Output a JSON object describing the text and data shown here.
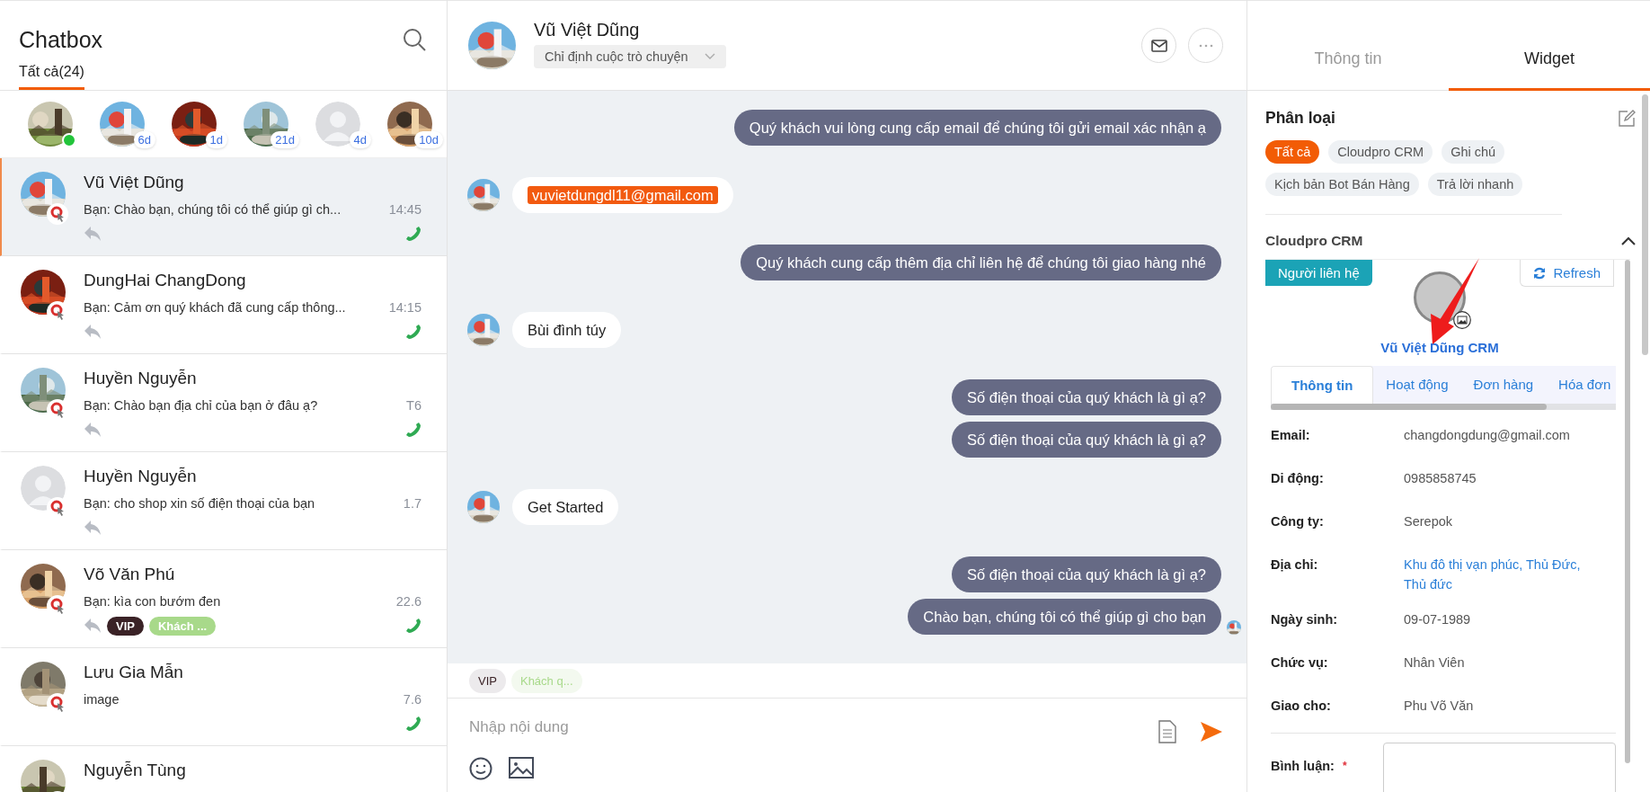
{
  "sidebar": {
    "title": "Chatbox",
    "tabs": [
      {
        "label": "Tất cả(24)",
        "selected": true
      }
    ],
    "recent": [
      {
        "kind": "picture",
        "online": true
      },
      {
        "kind": "picture",
        "online": false,
        "badge": "6d"
      },
      {
        "kind": "picture",
        "online": false,
        "badge": "1d"
      },
      {
        "kind": "picture",
        "online": false,
        "badge": "21d"
      },
      {
        "kind": "placeholder",
        "online": false,
        "badge": "4d"
      },
      {
        "kind": "picture",
        "online": false,
        "badge": "10d"
      }
    ],
    "conversations": [
      {
        "avatar": {
          "kind": "picture"
        },
        "name": "Vũ Việt Dũng",
        "preview": "Bạn: Chào bạn, chúng tôi có thể giúp gì ch...",
        "time": "14:45",
        "replied": true,
        "call": true,
        "selected": true
      },
      {
        "avatar": {
          "kind": "picture"
        },
        "name": "DungHai ChangDong",
        "preview": "Bạn: Cảm ơn quý khách đã cung cấp thông...",
        "time": "14:15",
        "replied": true,
        "call": true,
        "selected": false
      },
      {
        "avatar": {
          "kind": "picture"
        },
        "name": "Huyền Nguyễn",
        "preview": "Bạn: Chào bạn địa chỉ của bạn ở đâu ạ?",
        "time": "T6",
        "replied": true,
        "call": true,
        "selected": false
      },
      {
        "avatar": {
          "kind": "placeholder"
        },
        "name": "Huyền Nguyễn",
        "preview": "Bạn: cho shop xin số điện thoại của bạn",
        "time": "1.7",
        "replied": true,
        "call": false,
        "selected": false
      },
      {
        "avatar": {
          "kind": "picture"
        },
        "name": "Võ Văn Phú",
        "preview": "Bạn: kìa con bướm đen",
        "time": "22.6",
        "replied": true,
        "call": true,
        "selected": false,
        "tags": [
          {
            "label": "VIP",
            "color": "#3a2226"
          },
          {
            "label": "Khách ...",
            "color": "#a8d98a"
          }
        ]
      },
      {
        "avatar": {
          "kind": "picture"
        },
        "name": "Lưu Gia Mẫn",
        "preview": "image",
        "time": "7.6",
        "replied": false,
        "call": true,
        "selected": false
      },
      {
        "avatar": {
          "kind": "picture"
        },
        "name": "Nguyễn Tùng",
        "selected": false
      }
    ]
  },
  "chat": {
    "contact": "Vũ Việt Dũng",
    "assign": "Chỉ định cuộc trò chuyện",
    "messages": [
      {
        "kind": "outgoing",
        "text": "Quý khách vui lòng cung cấp email để chúng tôi gửi email xác nhận ạ"
      },
      {
        "kind": "incoming",
        "text": "vuvietdungdl11@gmail.com",
        "highlight": true
      },
      {
        "kind": "outgoing",
        "text": "Quý khách cung cấp thêm địa chỉ liên hệ để chúng tôi giao hàng nhé"
      },
      {
        "kind": "incoming",
        "text": "Bùi đình túy"
      },
      {
        "kind": "outgoing",
        "text": "Số điện thoại của quý khách là gì ạ?"
      },
      {
        "kind": "outgoing",
        "text": "Số điện thoại của quý khách là gì ạ?"
      },
      {
        "kind": "incoming",
        "text": "Get Started"
      },
      {
        "kind": "outgoing",
        "text": "Số điện thoại của quý khách là gì ạ?"
      },
      {
        "kind": "outgoing",
        "text": "Chào bạn, chúng tôi có thể giúp gì cho bạn",
        "seen": true
      }
    ],
    "tags": [
      {
        "label": "VIP",
        "color": "#3a2226"
      },
      {
        "label": "Khách q...",
        "color": "#a8d98a"
      }
    ],
    "composer": {
      "placeholder": "Nhập nội dung"
    }
  },
  "panel": {
    "tabs": [
      {
        "label": "Thông tin",
        "selected": false
      },
      {
        "label": "Widget",
        "selected": true
      }
    ],
    "category_title": "Phân loại",
    "categories": [
      {
        "label": "Tất cả",
        "selected": true
      },
      {
        "label": "Cloudpro CRM",
        "selected": false
      },
      {
        "label": "Ghi chú",
        "selected": false
      },
      {
        "label": "Kịch bản Bot Bán Hàng",
        "selected": false
      },
      {
        "label": "Trả lời nhanh",
        "selected": false
      }
    ],
    "crm": {
      "title": "Cloudpro CRM",
      "expanded": true,
      "type_button": "Người liên hệ",
      "refresh": "Refresh",
      "record_name": "Vũ Việt Dũng CRM",
      "tabs": [
        {
          "label": "Thông tin",
          "selected": true
        },
        {
          "label": "Hoạt động",
          "selected": false
        },
        {
          "label": "Đơn hàng",
          "selected": false
        },
        {
          "label": "Hóa đơn",
          "selected": false
        }
      ],
      "fields": [
        {
          "label": "Email:",
          "value": "changdongdung@gmail.com",
          "kind": "text"
        },
        {
          "label": "Di động:",
          "value": "0985858745",
          "kind": "text"
        },
        {
          "label": "Công ty:",
          "value": "Serepok",
          "kind": "text"
        },
        {
          "label": "Địa chỉ:",
          "value": "Khu đô thị vạn phúc, Thủ Đức, Thủ đức",
          "kind": "link"
        },
        {
          "label": "Ngày sinh:",
          "value": "09-07-1989",
          "kind": "text"
        },
        {
          "label": "Chức vụ:",
          "value": "Nhân Viên",
          "kind": "text"
        },
        {
          "label": "Giao cho:",
          "value": "Phu Võ Văn",
          "kind": "text"
        }
      ],
      "comment": {
        "label": "Bình luận:",
        "required_mark": "*"
      }
    }
  }
}
